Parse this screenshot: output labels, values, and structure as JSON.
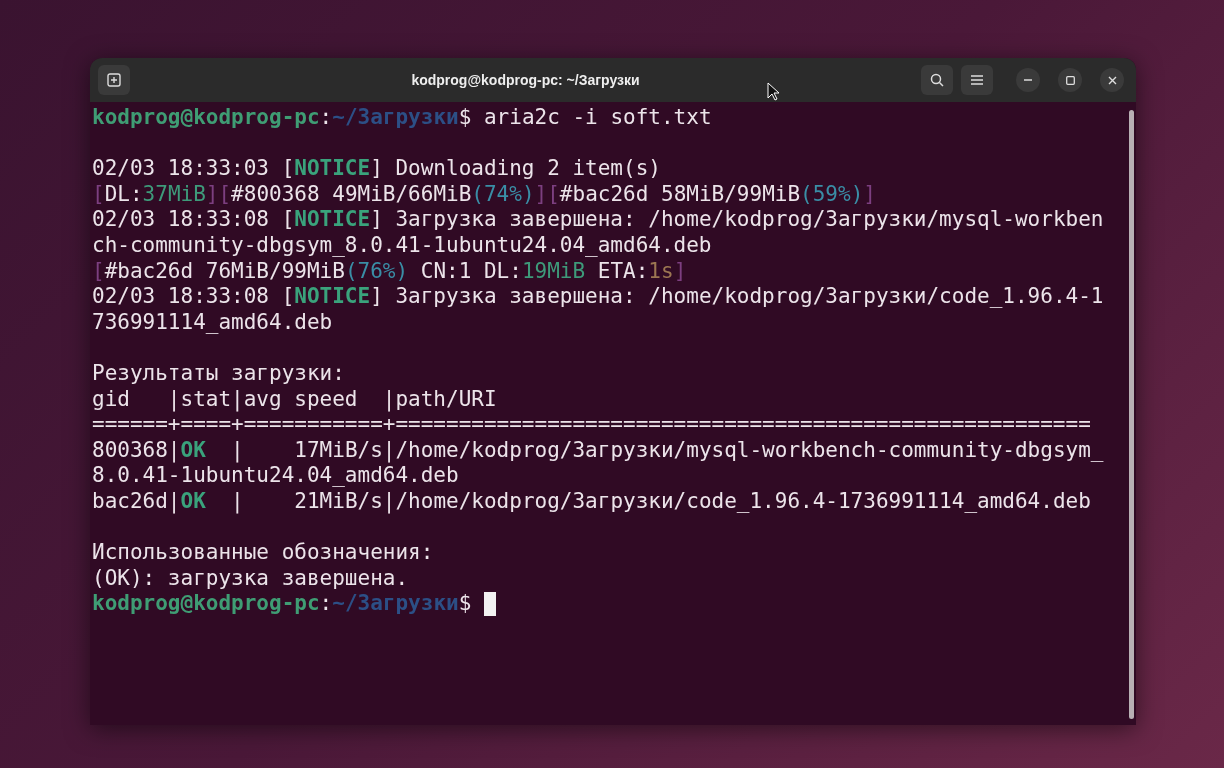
{
  "window": {
    "title": "kodprog@kodprog-pc: ~/Загрузки"
  },
  "terminal": {
    "cursor": true,
    "blocks": [
      [
        [
          {
            "kind": "user",
            "text": "kodprog@kodprog-pc"
          },
          {
            "kind": "plain",
            "text": ":"
          },
          {
            "kind": "path",
            "text": "~/Загрузки"
          },
          {
            "kind": "plain",
            "text": "$ aria2c -i soft.txt"
          }
        ]
      ],
      [
        [
          {
            "kind": "plain",
            "text": "02/03 18:33:03 ["
          },
          {
            "kind": "notice",
            "text": "NOTICE"
          },
          {
            "kind": "plain",
            "text": "] Downloading 2 item(s)"
          }
        ],
        [
          {
            "kind": "bracket",
            "text": "["
          },
          {
            "kind": "plain",
            "text": "DL:"
          },
          {
            "kind": "speed",
            "text": "37MiB"
          },
          {
            "kind": "bracket",
            "text": "]["
          },
          {
            "kind": "plain",
            "text": "#800368 49MiB/66MiB"
          },
          {
            "kind": "percent",
            "text": "(74%)"
          },
          {
            "kind": "bracket",
            "text": "]["
          },
          {
            "kind": "plain",
            "text": "#bac26d 58MiB/99MiB"
          },
          {
            "kind": "percent",
            "text": "(59%)"
          },
          {
            "kind": "bracket",
            "text": "]"
          }
        ],
        [
          {
            "kind": "plain",
            "text": "02/03 18:33:08 ["
          },
          {
            "kind": "notice",
            "text": "NOTICE"
          },
          {
            "kind": "plain",
            "text": "] Загрузка завершена: /home/kodprog/Загрузки/mysql-workben"
          }
        ],
        [
          {
            "kind": "plain",
            "text": "ch-community-dbgsym_8.0.41-1ubuntu24.04_amd64.deb"
          }
        ],
        [
          {
            "kind": "bracket",
            "text": "["
          },
          {
            "kind": "plain",
            "text": "#bac26d 76MiB/99MiB"
          },
          {
            "kind": "percent",
            "text": "(76%)"
          },
          {
            "kind": "plain",
            "text": " CN:1 DL:"
          },
          {
            "kind": "speed",
            "text": "19MiB"
          },
          {
            "kind": "plain",
            "text": " ETA:"
          },
          {
            "kind": "eta",
            "text": "1s"
          },
          {
            "kind": "bracket",
            "text": "]"
          }
        ],
        [
          {
            "kind": "plain",
            "text": "02/03 18:33:08 ["
          },
          {
            "kind": "notice",
            "text": "NOTICE"
          },
          {
            "kind": "plain",
            "text": "] Загрузка завершена: /home/kodprog/Загрузки/code_1.96.4-1"
          }
        ],
        [
          {
            "kind": "plain",
            "text": "736991114_amd64.deb"
          }
        ]
      ],
      [
        [
          {
            "kind": "plain",
            "text": "Результаты загрузки:"
          }
        ],
        [
          {
            "kind": "plain",
            "text": "gid   |stat|avg speed  |path/URI"
          }
        ],
        [
          {
            "kind": "plain",
            "text": "======+====+===========+======================================================="
          }
        ],
        [
          {
            "kind": "plain",
            "text": "800368|"
          },
          {
            "kind": "notice",
            "text": "OK"
          },
          {
            "kind": "plain",
            "text": "  |    17MiB/s|/home/kodprog/Загрузки/mysql-workbench-community-dbgsym_"
          }
        ],
        [
          {
            "kind": "plain",
            "text": "8.0.41-1ubuntu24.04_amd64.deb"
          }
        ],
        [
          {
            "kind": "plain",
            "text": "bac26d|"
          },
          {
            "kind": "notice",
            "text": "OK"
          },
          {
            "kind": "plain",
            "text": "  |    21MiB/s|/home/kodprog/Загрузки/code_1.96.4-1736991114_amd64.deb"
          }
        ]
      ],
      [
        [
          {
            "kind": "plain",
            "text": "Использованные обозначения:"
          }
        ],
        [
          {
            "kind": "plain",
            "text": "(OK): загрузка завершена."
          }
        ],
        [
          {
            "kind": "user",
            "text": "kodprog@kodprog-pc"
          },
          {
            "kind": "plain",
            "text": ":"
          },
          {
            "kind": "path",
            "text": "~/Загрузки"
          },
          {
            "kind": "plain",
            "text": "$ "
          }
        ]
      ]
    ]
  }
}
